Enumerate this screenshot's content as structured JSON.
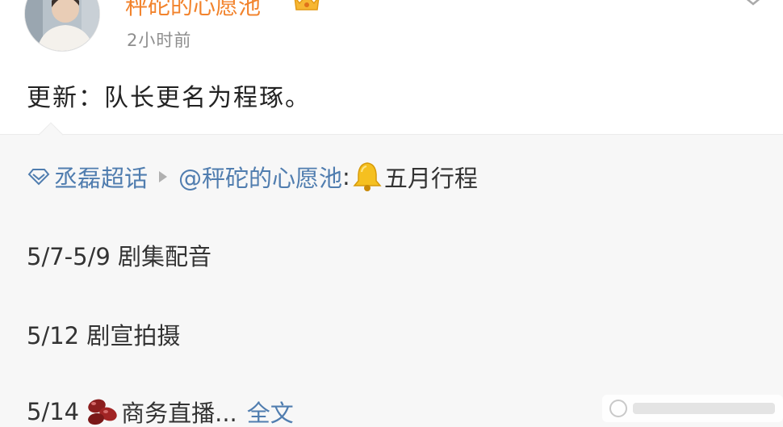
{
  "header": {
    "username": "秤砣的心愿池",
    "timestamp": "2小时前",
    "vip_icon": "crown-badge-icon",
    "more_icon": "chevron-down-icon",
    "avatar_icon": "avatar"
  },
  "post": {
    "text": "更新：队长更名为程琢。"
  },
  "repost": {
    "supertopic_icon": "diamond-icon",
    "supertopic": "丞磊超话",
    "separator_icon": "arrow-right-icon",
    "mention": "@秤砣的心愿池",
    "colon": ":",
    "bell_icon": "bell-icon",
    "title": "五月行程",
    "lines": [
      "5/7-5/9 剧集配音",
      "5/12 剧宣拍摄"
    ],
    "line3_date": "5/14",
    "bean_icon": "bean-emoji-icon",
    "line3_text": "商务直播...",
    "full_text_link": "全文"
  },
  "colors": {
    "username": "#f2832c",
    "link": "#507daf",
    "card_bg": "#f7f7f7",
    "text": "#222222",
    "muted": "#8e8e8e"
  }
}
